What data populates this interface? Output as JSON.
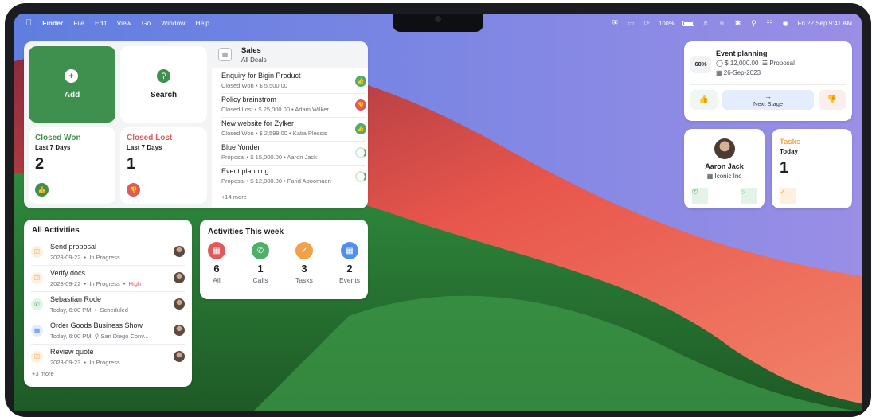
{
  "menubar": {
    "apple": "",
    "app": "Finder",
    "menus": [
      "File",
      "Edit",
      "View",
      "Go",
      "Window",
      "Help"
    ],
    "battery": "100%",
    "clock": "Fri 22 Sep  9:41 AM"
  },
  "tiles": {
    "add_label": "Add",
    "search_label": "Search",
    "closed_won": {
      "title": "Closed Won",
      "period": "Last 7 Days",
      "count": "2"
    },
    "closed_lost": {
      "title": "Closed Lost",
      "period": "Last 7 Days",
      "count": "1"
    }
  },
  "sales": {
    "title": "Sales",
    "subtitle": "All Deals",
    "deals": [
      {
        "name": "Enquiry for Bigin Product",
        "meta": "Closed Won • $ 5,500.00",
        "status": "won"
      },
      {
        "name": "Policy brainstrom",
        "meta": "Closed Lost • $ 25,000.00 • Adam Wilker",
        "status": "lost"
      },
      {
        "name": "New website for Zylker",
        "meta": "Closed Won • $ 2,599.00 • Katia Plessis",
        "status": "won"
      },
      {
        "name": "Blue Yonder",
        "meta": "Proposal • $ 15,000.00 • Aaron Jack",
        "status": "open"
      },
      {
        "name": "Event planning",
        "meta": "Proposal • $ 12,000.00 • Farid Aboomaeri",
        "status": "open"
      }
    ],
    "more": "+14 more"
  },
  "activities": {
    "title": "All Activities",
    "items": [
      {
        "name": "Send proposal",
        "date": "2023-09-22",
        "status": "In Progress",
        "priority": "",
        "type": "task"
      },
      {
        "name": "Verify docs",
        "date": "2023-09-22",
        "status": "In Progress",
        "priority": "High",
        "type": "task"
      },
      {
        "name": "Sebastian Rode",
        "date": "Today, 6:00 PM",
        "status": "Scheduled",
        "priority": "",
        "type": "call"
      },
      {
        "name": "Order Goods Business Show",
        "date": "Today, 6:00 PM",
        "status": "San Diego Conv...",
        "priority": "",
        "type": "event"
      },
      {
        "name": "Review quote",
        "date": "2023-09-23",
        "status": "In Progress",
        "priority": "",
        "type": "task"
      }
    ],
    "more": "+3 more"
  },
  "week": {
    "title": "Activities This week",
    "items": [
      {
        "count": "6",
        "label": "All",
        "color": "#e05a5a"
      },
      {
        "count": "1",
        "label": "Calls",
        "color": "#4fae6a"
      },
      {
        "count": "3",
        "label": "Tasks",
        "color": "#f0a24a"
      },
      {
        "count": "2",
        "label": "Events",
        "color": "#4f8ff0"
      }
    ]
  },
  "event_card": {
    "percent": "60%",
    "title": "Event planning",
    "amount": "$ 12,000.00",
    "stage": "Proposal",
    "date": "26-Sep-2023",
    "next_label": "Next Stage",
    "arrow": "→"
  },
  "contact": {
    "name": "Aaron Jack",
    "company": "Iconic Inc"
  },
  "tasks": {
    "title": "Tasks",
    "period": "Today",
    "count": "1"
  },
  "colors": {
    "green": "#3f8f4f",
    "red": "#e05a5a",
    "orange": "#f0a24a",
    "blue": "#4f8ff0"
  }
}
